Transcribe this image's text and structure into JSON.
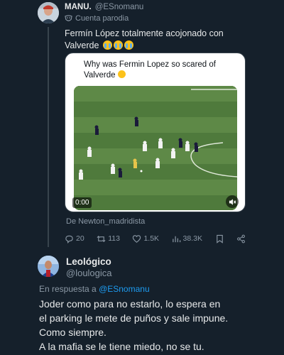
{
  "tweet": {
    "author_name": "MANU.",
    "author_handle": "@ESnomanu",
    "parody_label": "Cuenta parodia",
    "text": "Fermín López totalmente acojonado con Valverde",
    "text_emojis": [
      "loudly-crying-face",
      "loudly-crying-face",
      "loudly-crying-face"
    ],
    "quote": {
      "text": "Why was Fermin Lopez so scared of Valverde",
      "text_emoji": "grinning-squinting-face",
      "video_time": "0:00",
      "video_sound": "muted"
    },
    "source": "De Newton_madridista",
    "actions": {
      "replies": "20",
      "retweets": "113",
      "likes": "1.5K",
      "views": "38.3K"
    }
  },
  "reply": {
    "author_name": "Leológico",
    "author_handle": "@loulogica",
    "reply_prefix": "En respuesta a",
    "reply_mention": "@ESnomanu",
    "lines": [
      "Joder como para no estarlo, lo espera en",
      "el parking le mete de puños y sale impune.",
      "Como siempre.",
      "A la mafia se le tiene miedo, no se tu."
    ]
  },
  "colors": {
    "background": "#15202b",
    "text_primary": "#e7e9ea",
    "text_secondary": "#8b98a5",
    "accent": "#1d9bf0",
    "border": "#38444d"
  }
}
